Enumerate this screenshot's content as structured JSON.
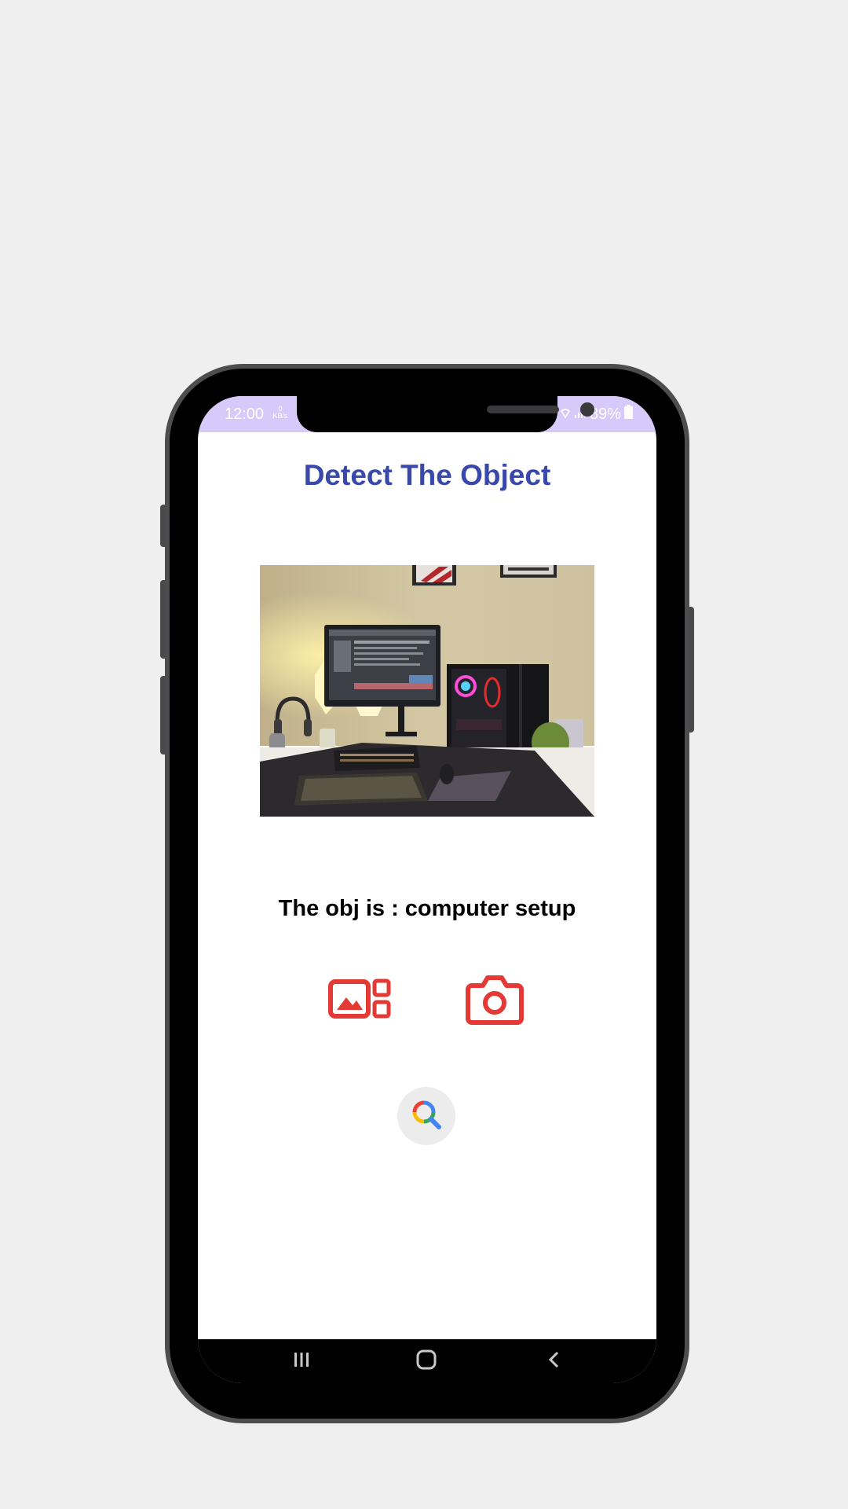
{
  "status_bar": {
    "time": "12:00",
    "net_speed_value": "0",
    "net_speed_unit": "KB/s",
    "battery": "89%",
    "background_color": "#d8c9fb"
  },
  "app": {
    "title": "Detect The Object",
    "title_color": "#3949ab",
    "result_text": "The obj is : computer setup",
    "accent_color": "#e53935"
  },
  "actions": {
    "gallery_icon": "gallery-icon",
    "camera_icon": "camera-icon",
    "search_icon": "search-icon"
  },
  "nav_bar": {
    "recent_icon": "recent-apps-icon",
    "home_icon": "home-icon",
    "back_icon": "back-icon"
  }
}
